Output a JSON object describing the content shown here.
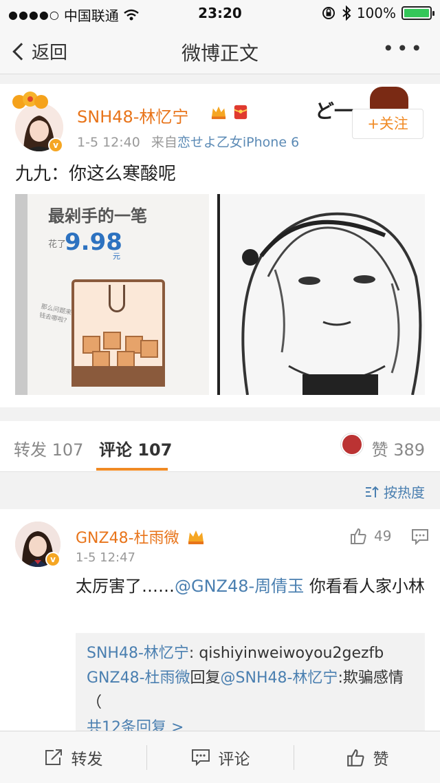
{
  "status_bar": {
    "carrier": "中国联通",
    "time": "23:20",
    "battery": "100%"
  },
  "nav": {
    "back_label": "返回",
    "title": "微博正文",
    "more_label": "•••"
  },
  "post": {
    "author": "SNH48-林忆宁",
    "time": "1-5 12:40",
    "source_prefix": "来自",
    "source": "恋せよ乙女iPhone 6",
    "follow_label": "+关注",
    "text": "九九：你这么寒酸呢",
    "image_left": {
      "headline": "最剁手的一笔",
      "spent_prefix": "花了",
      "amount": "9.98",
      "unit": "元",
      "note": "那么问题来了 钱去哪啦?"
    },
    "deco_text": "ど一"
  },
  "tabs": {
    "repost": "转发 107",
    "comment": "评论 107",
    "like": "赞 389"
  },
  "sort": {
    "label": "按热度"
  },
  "comment": {
    "author": "GNZ48-杜雨微",
    "time": "1-5 12:47",
    "likes": "49",
    "text_before": "太厉害了……",
    "mention": "@GNZ48-周倩玉",
    "text_after": " 你看看人家小林",
    "replies": [
      {
        "author": "SNH48-林忆宁",
        "sep": ": ",
        "text": "qishiyinweiwoyou2gezfb"
      },
      {
        "author": "GNZ48-杜雨微",
        "sep": "回复",
        "target": "@SNH48-林忆宁",
        "text": ":欺骗感情（"
      }
    ],
    "more_replies": "共12条回复 >"
  },
  "bottom_bar": {
    "repost": "转发",
    "comment": "评论",
    "like": "赞"
  },
  "colors": {
    "accent_orange": "#f08a24",
    "name_orange": "#e8741a",
    "link_blue": "#4a7fb0",
    "battery_green": "#34c759"
  },
  "icons": [
    "signal-dots-icon",
    "wifi-icon",
    "lock-rotation-icon",
    "bluetooth-icon",
    "battery-icon",
    "back-chevron-icon",
    "more-icon",
    "crown-icon",
    "red-packet-icon",
    "verified-icon",
    "sort-icon",
    "thumb-up-icon",
    "comment-icon",
    "repost-icon"
  ]
}
